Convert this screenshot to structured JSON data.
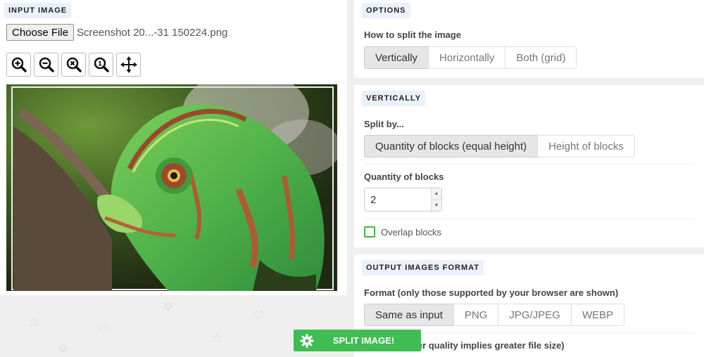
{
  "input": {
    "section_label": "INPUT IMAGE",
    "choose_file_label": "Choose File",
    "file_name": "Screenshot 20...-31 150224.png",
    "tools": [
      "zoom-in-icon",
      "zoom-out-icon",
      "zoom-reset-icon",
      "zoom-actual-icon",
      "move-icon"
    ],
    "image_alt": "chameleon photo"
  },
  "options": {
    "section_label": "OPTIONS",
    "split_question": "How to split the image",
    "split_modes": [
      "Vertically",
      "Horizontally",
      "Both (grid)"
    ],
    "split_mode_selected": "Vertically"
  },
  "vertically": {
    "section_label": "VERTICALLY",
    "split_by_label": "Split by...",
    "split_by_options": [
      "Quantity of blocks (equal height)",
      "Height of blocks"
    ],
    "quantity_label": "Quantity of blocks",
    "quantity_value": "2",
    "overlap_label": "Overlap blocks",
    "overlap_checked": false
  },
  "output": {
    "section_label": "OUTPUT IMAGES FORMAT",
    "format_label": "Format (only those supported by your browser are shown)",
    "formats": [
      "Same as input",
      "PNG",
      "JPG/JPEG",
      "WEBP"
    ],
    "format_selected": "Same as input",
    "quality_label": "Quality (better quality implies greater file size)"
  },
  "action": {
    "split_button_label": "SPLIT IMAGE!"
  },
  "colors": {
    "accent_green": "#3fbd52",
    "section_tag_bg": "#eaf1fb"
  }
}
